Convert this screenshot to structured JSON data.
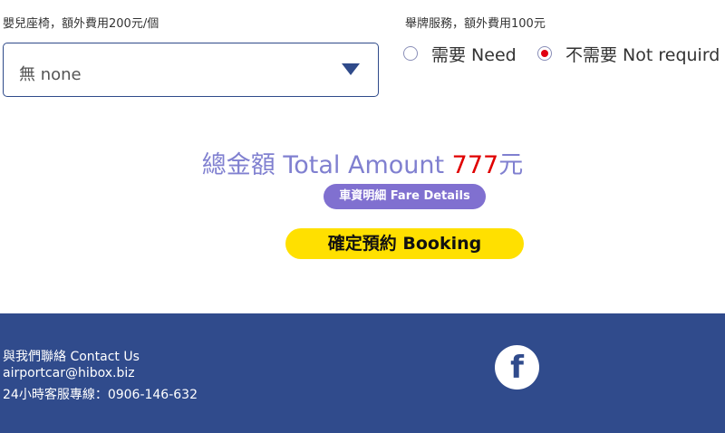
{
  "child_seat": {
    "label": "嬰兒座椅，額外費用200元/個",
    "selected": "無 none"
  },
  "sign_service": {
    "label": "舉牌服務，額外費用100元",
    "options": [
      "需要 Need",
      "不需要 Not requird"
    ],
    "selected_index": 1
  },
  "total": {
    "prefix": "總金額 Total Amount ",
    "amount": "777",
    "unit": "元"
  },
  "fare_details_label": "車資明細 Fare Details",
  "booking_label": "確定預約 Booking",
  "footer": {
    "contact": "與我們聯絡 Contact Us",
    "email": "airportcar@hibox.biz",
    "phone": "24小時客服專線：0906-146-632",
    "facebook_icon": "facebook-icon"
  },
  "colors": {
    "footer_bg": "#304b8c",
    "total_text": "#8080d0",
    "amount": "#e00000",
    "fare_button": "#8070d0",
    "booking_button": "#ffe000"
  }
}
